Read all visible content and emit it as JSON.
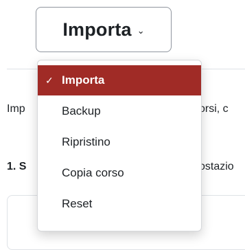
{
  "select": {
    "label": "Importa",
    "chevron": "⌄"
  },
  "background": {
    "intro_left": "Imp",
    "intro_right": "orsi, c",
    "step_left": "1. S",
    "step_right": "ostazio"
  },
  "menu": {
    "check_icon": "✓",
    "items": [
      {
        "label": "Importa",
        "selected": true
      },
      {
        "label": "Backup",
        "selected": false
      },
      {
        "label": "Ripristino",
        "selected": false
      },
      {
        "label": "Copia corso",
        "selected": false
      },
      {
        "label": "Reset",
        "selected": false
      }
    ]
  },
  "colors": {
    "accent": "#a02b26",
    "text": "#1d2125",
    "border": "#8f959e"
  }
}
